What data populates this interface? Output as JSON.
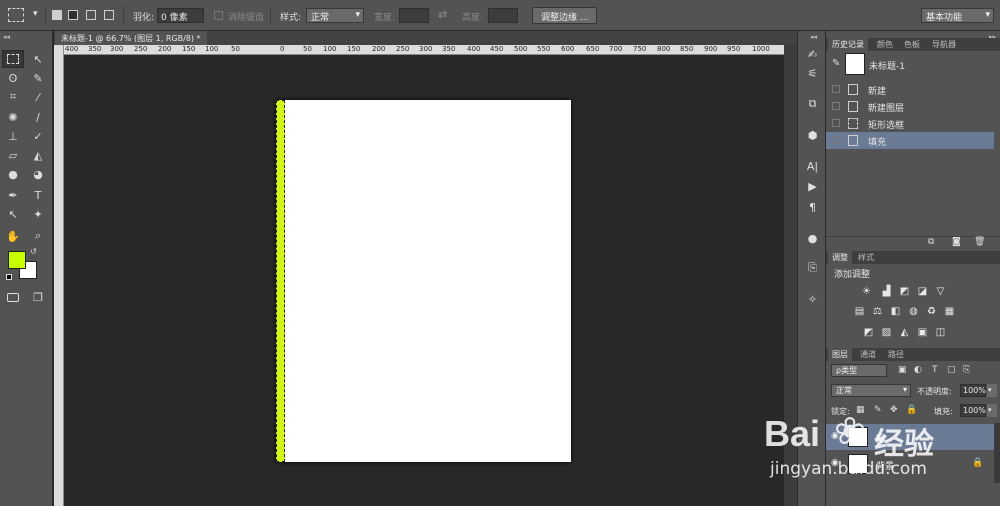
{
  "options_bar": {
    "feather_label": "羽化:",
    "feather_value": "0 像素",
    "antialias_label": "消除锯齿",
    "style_label": "样式:",
    "style_value": "正常",
    "width_label": "宽度:",
    "height_label": "高度:",
    "refine_edge_button": "调整边缘 ...",
    "workspace_value": "基本功能"
  },
  "document": {
    "tab_title": "未标题-1 @ 66.7% (图层 1, RGB/8) *",
    "ruler_ticks": [
      "400",
      "350",
      "300",
      "250",
      "200",
      "150",
      "100",
      "50",
      "0",
      "50",
      "100",
      "150",
      "200",
      "250",
      "300",
      "350",
      "400",
      "450",
      "500",
      "550",
      "600",
      "650",
      "700",
      "750",
      "800",
      "850",
      "900",
      "950",
      "1000"
    ],
    "fill_color": "#d4f51a",
    "canvas_color": "#ffffff"
  },
  "toolbox": {
    "foreground_color": "#c8ff00",
    "background_color": "#ffffff"
  },
  "history_panel": {
    "tabs": [
      "历史记录",
      "颜色",
      "色板",
      "导航器"
    ],
    "snapshot_label": "未标题-1",
    "items": [
      {
        "label": "新建",
        "selected": false
      },
      {
        "label": "新建图层",
        "selected": false
      },
      {
        "label": "矩形选框",
        "selected": false
      },
      {
        "label": "填充",
        "selected": true
      }
    ]
  },
  "adjustments_panel": {
    "tabs": [
      "调整",
      "样式"
    ],
    "title": "添加调整"
  },
  "layers_panel": {
    "tabs": [
      "图层",
      "通道",
      "路径"
    ],
    "filter_value": "ρ类型",
    "blend_mode": "正常",
    "opacity_label": "不透明度:",
    "opacity_value": "100%",
    "lock_label": "锁定:",
    "fill_label": "填充:",
    "fill_value": "100%",
    "layer1_name": "图",
    "background_layer_name": "背景"
  },
  "watermark": {
    "brand": "Bai",
    "brand_suffix": "经验",
    "url": "jingyan.baidu.com"
  }
}
